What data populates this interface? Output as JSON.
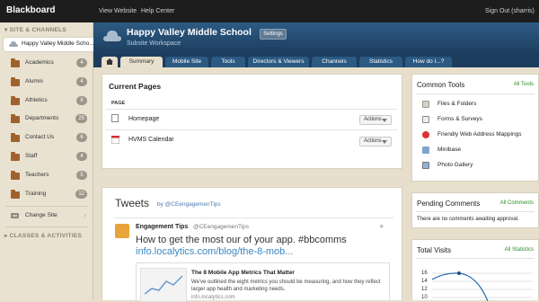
{
  "topbar": {
    "logo": "Blackboard",
    "links": [
      "View Website",
      "Help Center"
    ],
    "sign_out": "Sign Out (sharris)"
  },
  "sidebar": {
    "section1": "SITE & CHANNELS",
    "current_site": "Happy Valley Middle Scho...",
    "items": [
      {
        "label": "Academics",
        "count": "4"
      },
      {
        "label": "Alumni",
        "count": "4"
      },
      {
        "label": "Athletics",
        "count": "8"
      },
      {
        "label": "Departments",
        "count": "25"
      },
      {
        "label": "Contact Us",
        "count": "6"
      },
      {
        "label": "Staff",
        "count": "4"
      },
      {
        "label": "Teachers",
        "count": "5"
      },
      {
        "label": "Training",
        "count": "12"
      }
    ],
    "change_site": "Change Site",
    "section2": "CLASSES & ACTIVITIES"
  },
  "hero": {
    "title": "Happy Valley Middle School",
    "subtitle": "Subsite Workspace",
    "settings": "Settings"
  },
  "tabs": [
    "Summary",
    "Mobile Site",
    "Tools",
    "Directors & Viewers",
    "Channels",
    "Statistics",
    "How do I...?"
  ],
  "current_pages": {
    "title": "Current Pages",
    "col": "PAGE",
    "rows": [
      {
        "name": "Homepage",
        "action": "Actions"
      },
      {
        "name": "HVMS Calendar",
        "action": "Actions"
      }
    ]
  },
  "tweets": {
    "title": "Tweets",
    "by": "by @CEengagemenTips",
    "author": "Engagement Tips",
    "handle": "@CEengagemenTips",
    "text1": "How to get the most our of your app. #bbcomms",
    "text2": "info.localytics.com/blog/the-8-mob...",
    "card_title": "The 8 Mobile App Metrics That Matter",
    "card_body": "We've outlined the eight metrics you should be measuring, and how they reflect larger app health and marketing needs.",
    "card_link": "info.localytics.com"
  },
  "common_tools": {
    "title": "Common Tools",
    "all": "All Tools",
    "items": [
      "Files & Folders",
      "Forms & Surveys",
      "Friendly Web Address Mappings",
      "Minibase",
      "Photo Gallery"
    ]
  },
  "pending": {
    "title": "Pending Comments",
    "all": "All Comments",
    "text": "There are no comments awaiting approval."
  },
  "visits": {
    "title": "Total Visits",
    "all": "All Statistics",
    "ticks": [
      "16",
      "14",
      "12",
      "10"
    ]
  },
  "colors": {
    "accent_blue": "#1c3d5d",
    "link_green": "#2d8a2d",
    "folder": "#a0622d"
  }
}
